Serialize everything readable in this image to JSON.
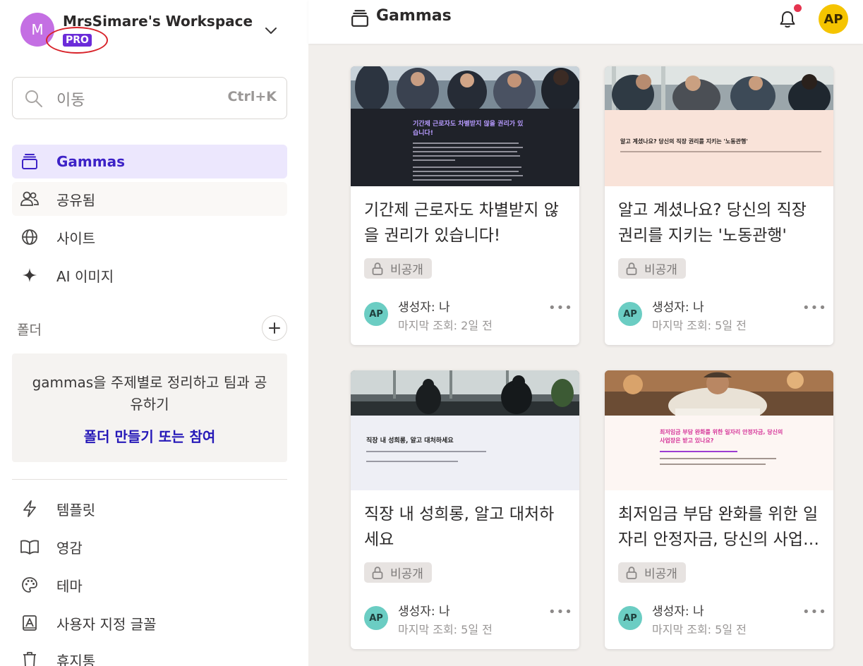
{
  "workspace": {
    "avatar_letter": "M",
    "name": "MrsSimare's Workspace",
    "plan_badge": "PRO"
  },
  "search": {
    "placeholder": "이동",
    "shortcut": "Ctrl+K"
  },
  "nav": [
    {
      "label": "Gammas",
      "icon": "stack-icon",
      "active": true
    },
    {
      "label": "공유됨",
      "icon": "people-icon"
    },
    {
      "label": "사이트",
      "icon": "globe-icon"
    },
    {
      "label": "AI 이미지",
      "icon": "sparkle-icon"
    }
  ],
  "folders": {
    "header": "폴더",
    "description": "gammas을 주제별로 정리하고 팀과 공유하기",
    "link": "폴더 만들기 또는 참여"
  },
  "bottom_nav": [
    {
      "label": "템플릿",
      "icon": "bolt-icon"
    },
    {
      "label": "영감",
      "icon": "book-icon"
    },
    {
      "label": "테마",
      "icon": "palette-icon"
    },
    {
      "label": "사용자 지정 글꼴",
      "icon": "font-icon"
    },
    {
      "label": "휴지통",
      "icon": "trash-icon"
    }
  ],
  "topbar": {
    "title": "Gammas",
    "user_initials": "AP"
  },
  "cards": [
    {
      "title": "기간제 근로자도 차별받지 않을 권리가 있습니다!",
      "slide_title": "기간제 근로자도 차별받지 않을 권리가 있습니다!",
      "visibility": "비공개",
      "owner_initials": "AP",
      "created_by": "생성자: 나",
      "last_viewed": "마지막 조회: 2일 전"
    },
    {
      "title": "알고 계셨나요? 당신의 직장 권리를 지키는 '노동관행'",
      "slide_title": "알고 계셨나요? 당신의 직장 권리를 지키는 '노동관행'",
      "visibility": "비공개",
      "owner_initials": "AP",
      "created_by": "생성자: 나",
      "last_viewed": "마지막 조회: 5일 전"
    },
    {
      "title": "직장 내 성희롱, 알고 대처하세요",
      "slide_title": "직장 내 성희롱, 알고 대처하세요",
      "visibility": "비공개",
      "owner_initials": "AP",
      "created_by": "생성자: 나",
      "last_viewed": "마지막 조회: 5일 전"
    },
    {
      "title": "최저임금 부담 완화를 위한 일자리 안정자금, 당신의 사업장은 받고 있나요?",
      "slide_title": "최저임금 부담 완화를 위한 일자리 안정자금, 당신의 사업장은 받고 있나요?",
      "visibility": "비공개",
      "owner_initials": "AP",
      "created_by": "생성자: 나",
      "last_viewed": "마지막 조회: 5일 전"
    }
  ],
  "colors": {
    "accent": "#3d22c7",
    "active_bg": "#ece7fd",
    "pro_badge": "#6b2bd9",
    "annotation_circle": "#d8232a",
    "notification_dot": "#e5344f",
    "user_avatar": "#f5c400",
    "owner_avatar": "#6bcdc3"
  }
}
